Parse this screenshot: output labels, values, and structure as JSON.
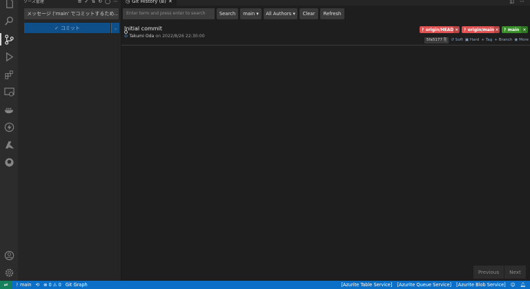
{
  "sidebar": {
    "title": "ソース管理",
    "message_placeholder": "メッセージ ('main' でコミットするため...",
    "commit_label": "コミット",
    "tools": [
      "≡",
      "✓",
      "⇅",
      "↻",
      "◯",
      "⋯"
    ]
  },
  "tab": {
    "title": "Git History (B)",
    "close": "✕"
  },
  "toolbar": {
    "search_placeholder": "Enter term and press enter to search",
    "search_label": "Search",
    "branch_label": "main",
    "authors_label": "All Authors",
    "clear_label": "Clear",
    "refresh_label": "Refresh"
  },
  "commit": {
    "message": "Initial commit",
    "author": "Takumi Oda",
    "on": "on",
    "date": "2022/8/26 22:30:00",
    "hash": "5fa5177",
    "refs": [
      {
        "name": "origin/HEAD",
        "color": "#e05252"
      },
      {
        "name": "origin/main",
        "color": "#e05252"
      },
      {
        "name": "main",
        "color": "#3a8f2b"
      }
    ],
    "actions": [
      "Soft",
      "Hard",
      "Tag",
      "Branch",
      "More"
    ]
  },
  "pager": {
    "previous": "Previous",
    "next": "Next"
  },
  "status": {
    "branch": "main",
    "errors": "0",
    "warnings": "0",
    "git_graph": "Git Graph",
    "azurite_table": "[Azurite Table Service]",
    "azurite_queue": "[Azurite Queue Service]",
    "azurite_blob": "[Azurite Blob Service]"
  }
}
